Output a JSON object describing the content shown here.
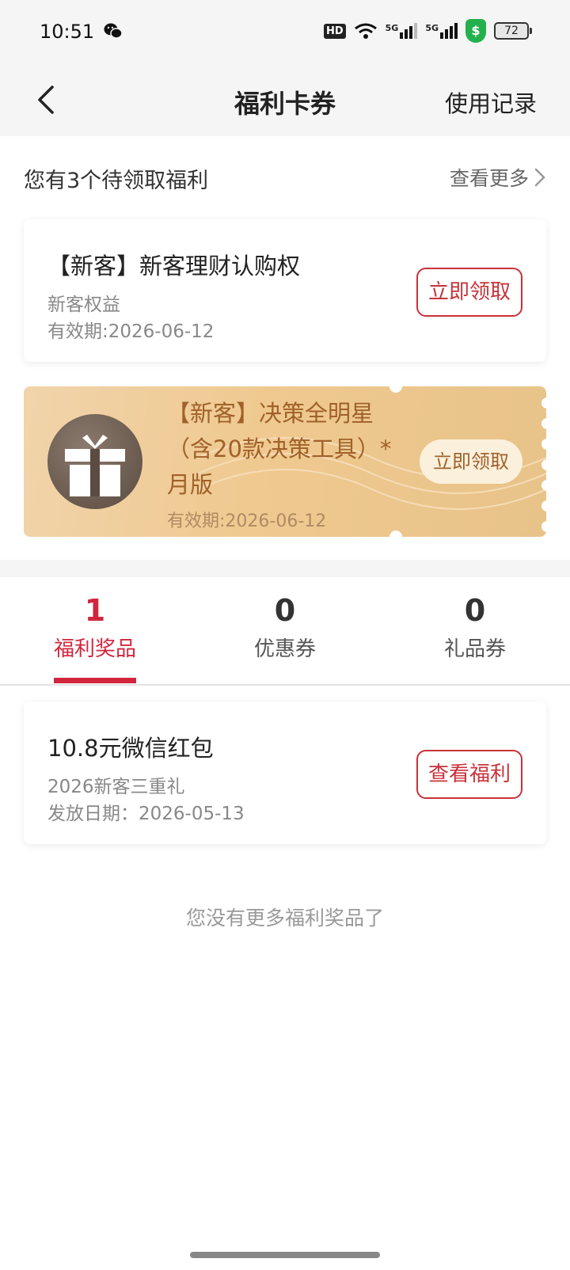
{
  "status_bar": {
    "time": "10:51",
    "hd": "HD",
    "net1": "5G",
    "net2": "5G",
    "battery": "72",
    "shield_symbol": "$"
  },
  "nav": {
    "title": "福利卡券",
    "right_action": "使用记录"
  },
  "pending": {
    "title": "您有3个待领取福利",
    "see_more": "查看更多"
  },
  "cards": [
    {
      "title": "【新客】新客理财认购权",
      "subtitle": "新客权益",
      "validity": "有效期:2026-06-12",
      "button": "立即领取"
    },
    {
      "title": "【新客】决策全明星（含20款决策工具）*月版",
      "validity": "有效期:2026-06-12",
      "button": "立即领取"
    }
  ],
  "tabs": [
    {
      "count": "1",
      "label": "福利奖品",
      "active": true
    },
    {
      "count": "0",
      "label": "优惠券",
      "active": false
    },
    {
      "count": "0",
      "label": "礼品券",
      "active": false
    }
  ],
  "prize": {
    "title": "10.8元微信红包",
    "subtitle": "2026新客三重礼",
    "date": "发放日期：2026-05-13",
    "button": "查看福利"
  },
  "no_more_text": "您没有更多福利奖品了",
  "colors": {
    "accent_red": "#d1263e",
    "gold_text": "#a0612a",
    "gold_bg": "#efc98f"
  }
}
